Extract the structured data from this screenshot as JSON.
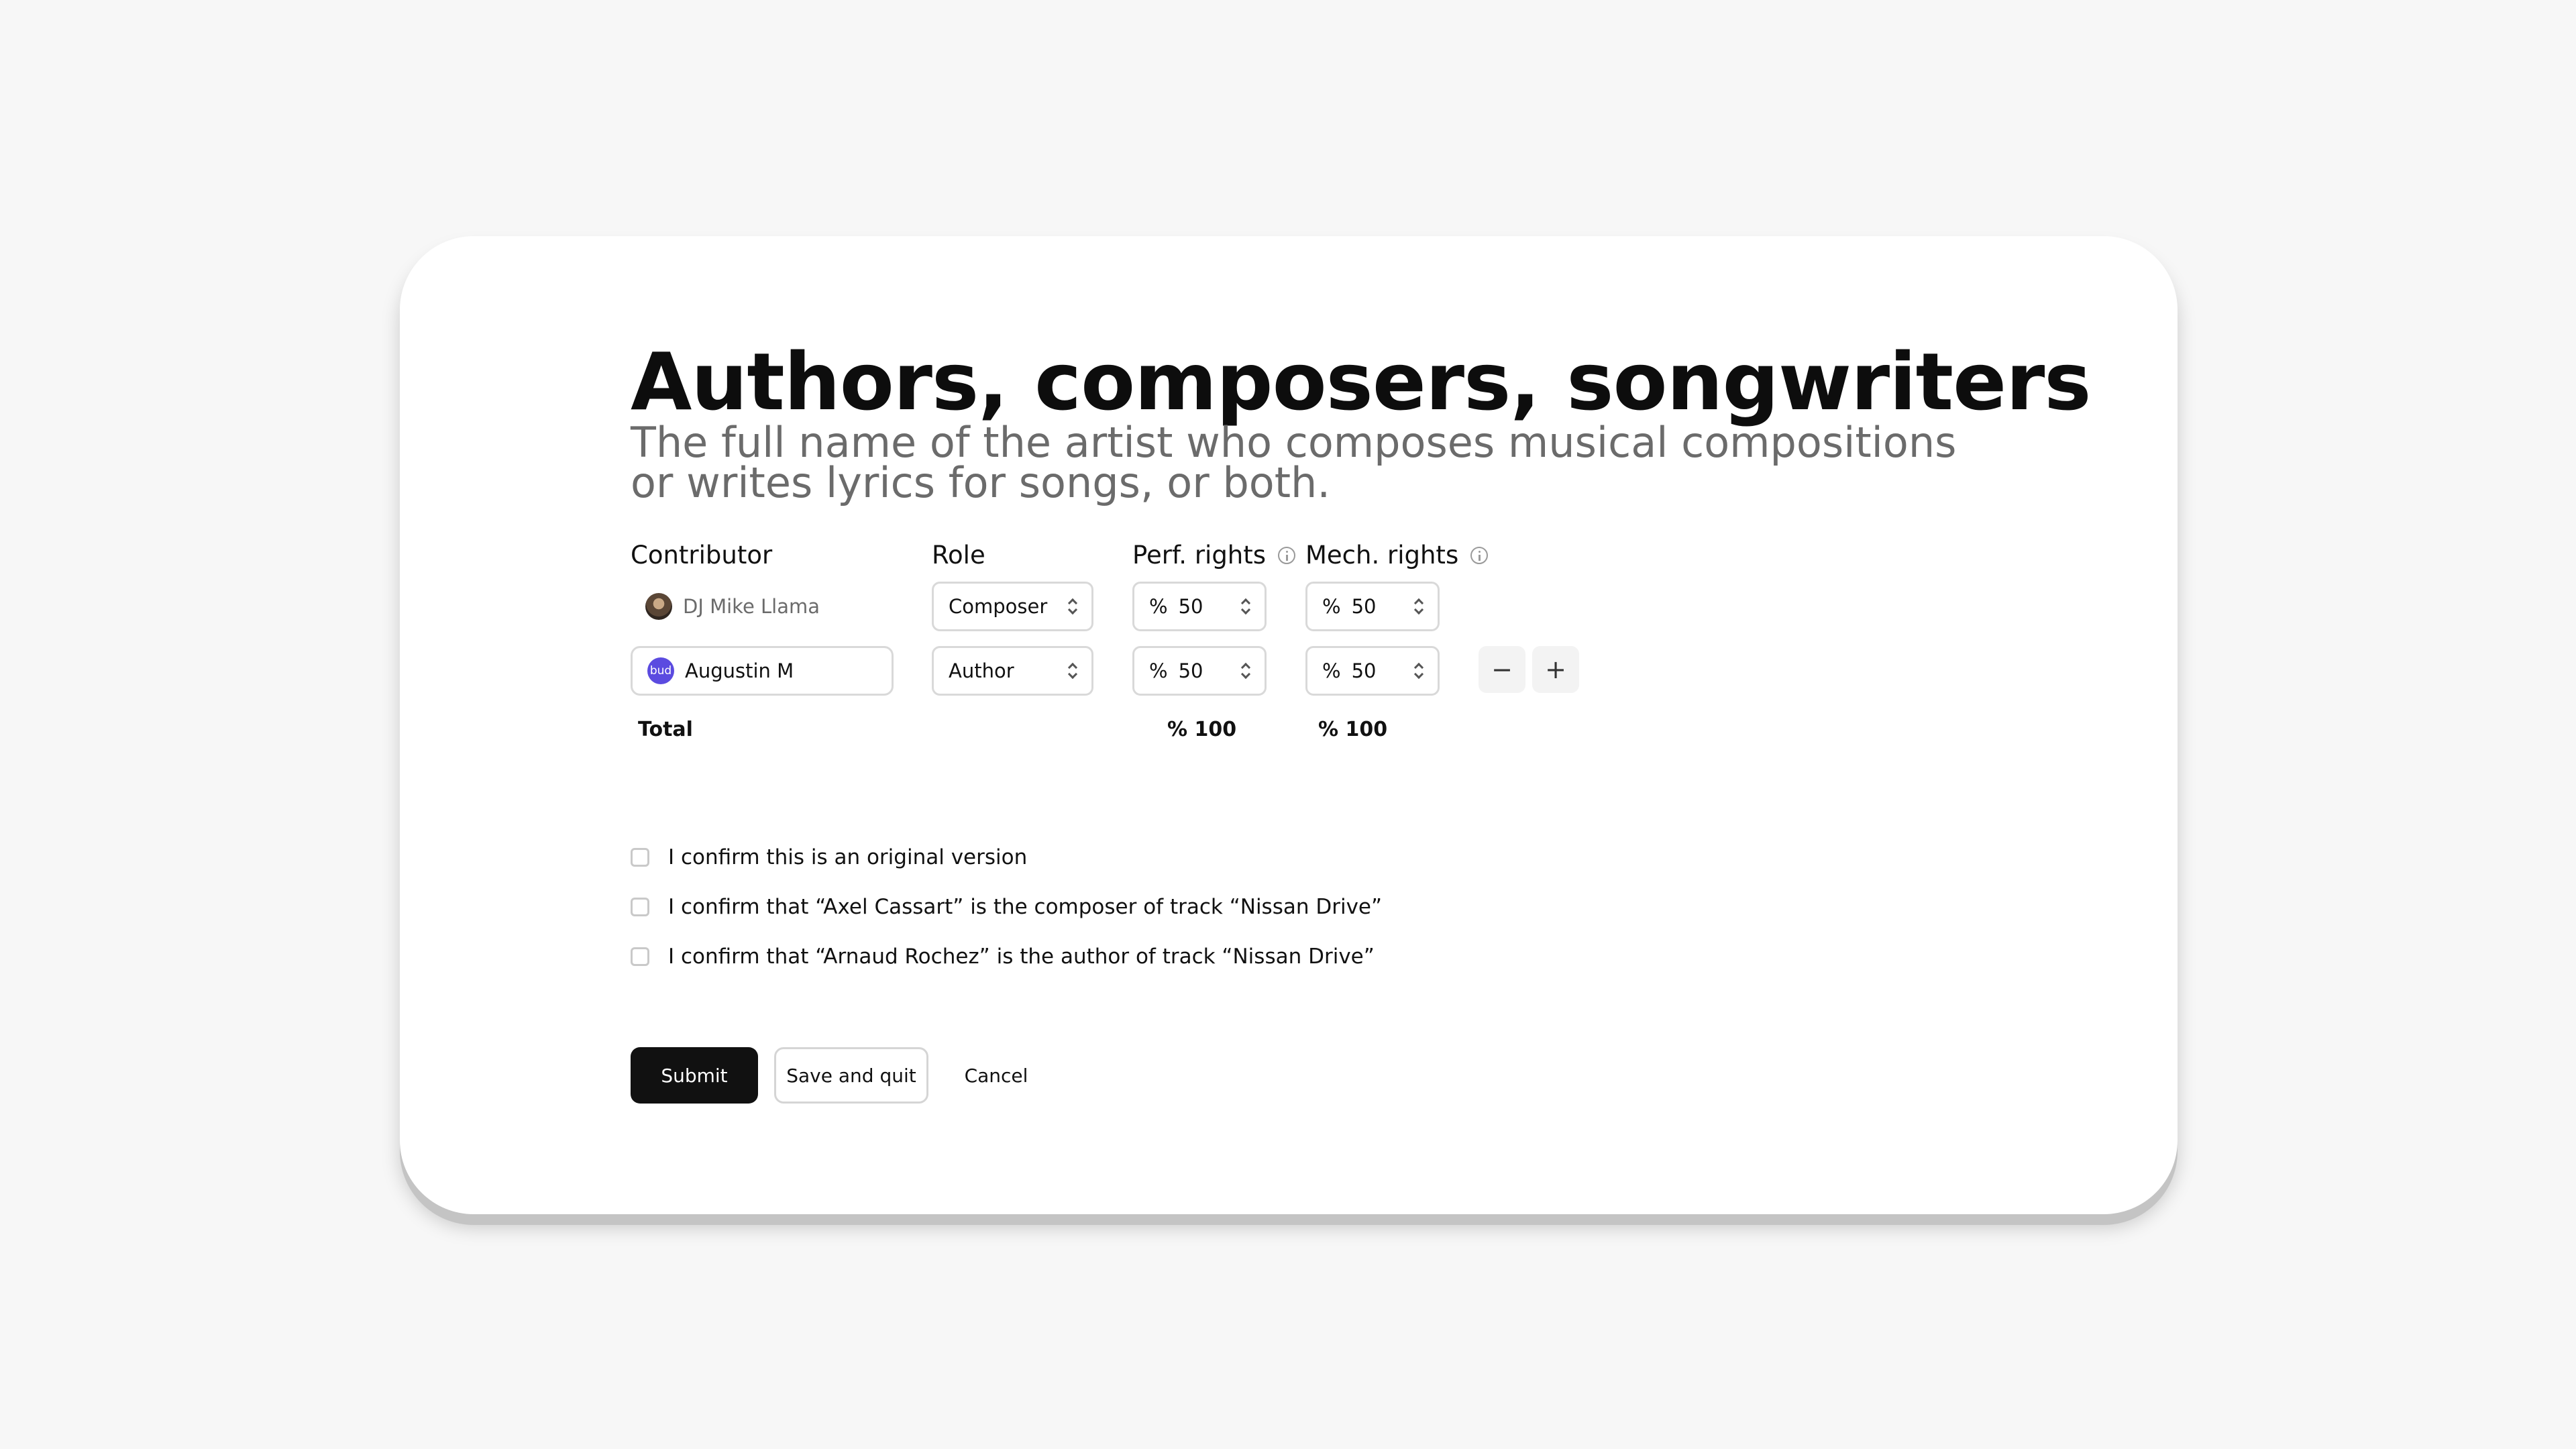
{
  "header": {
    "title": "Authors, composers, songwriters",
    "subtitle": "The full name of the artist who composes musical compositions or writes lyrics for songs, or both."
  },
  "columns": {
    "contributor": "Contributor",
    "role": "Role",
    "perf_rights": "Perf. rights",
    "mech_rights": "Mech. rights"
  },
  "rows": [
    {
      "contributor": "DJ Mike Llama",
      "role": "Composer",
      "perf_symbol": "%",
      "perf_value": "50",
      "mech_symbol": "%",
      "mech_value": "50"
    },
    {
      "contributor": "Augustin M",
      "avatar_text": "bud",
      "role": "Author",
      "perf_symbol": "%",
      "perf_value": "50",
      "mech_symbol": "%",
      "mech_value": "50"
    }
  ],
  "row_actions": {
    "remove_icon": "minus-icon",
    "add_icon": "plus-icon",
    "remove_glyph": "−",
    "add_glyph": "+"
  },
  "totals": {
    "label": "Total",
    "perf": "% 100",
    "mech": "% 100"
  },
  "confirmations": [
    {
      "label": "I confirm this is an original version",
      "checked": false
    },
    {
      "label": "I confirm that “Axel Cassart” is the composer of track “Nissan Drive”",
      "checked": false
    },
    {
      "label": "I confirm that “Arnaud Rochez” is the author of track “Nissan Drive”",
      "checked": false
    }
  ],
  "actions": {
    "submit": "Submit",
    "save_quit": "Save and quit",
    "cancel": "Cancel"
  },
  "colors": {
    "primary_button": "#111111",
    "logo_avatar": "#5b4be0",
    "subtitle_text": "#6b6b6b"
  }
}
